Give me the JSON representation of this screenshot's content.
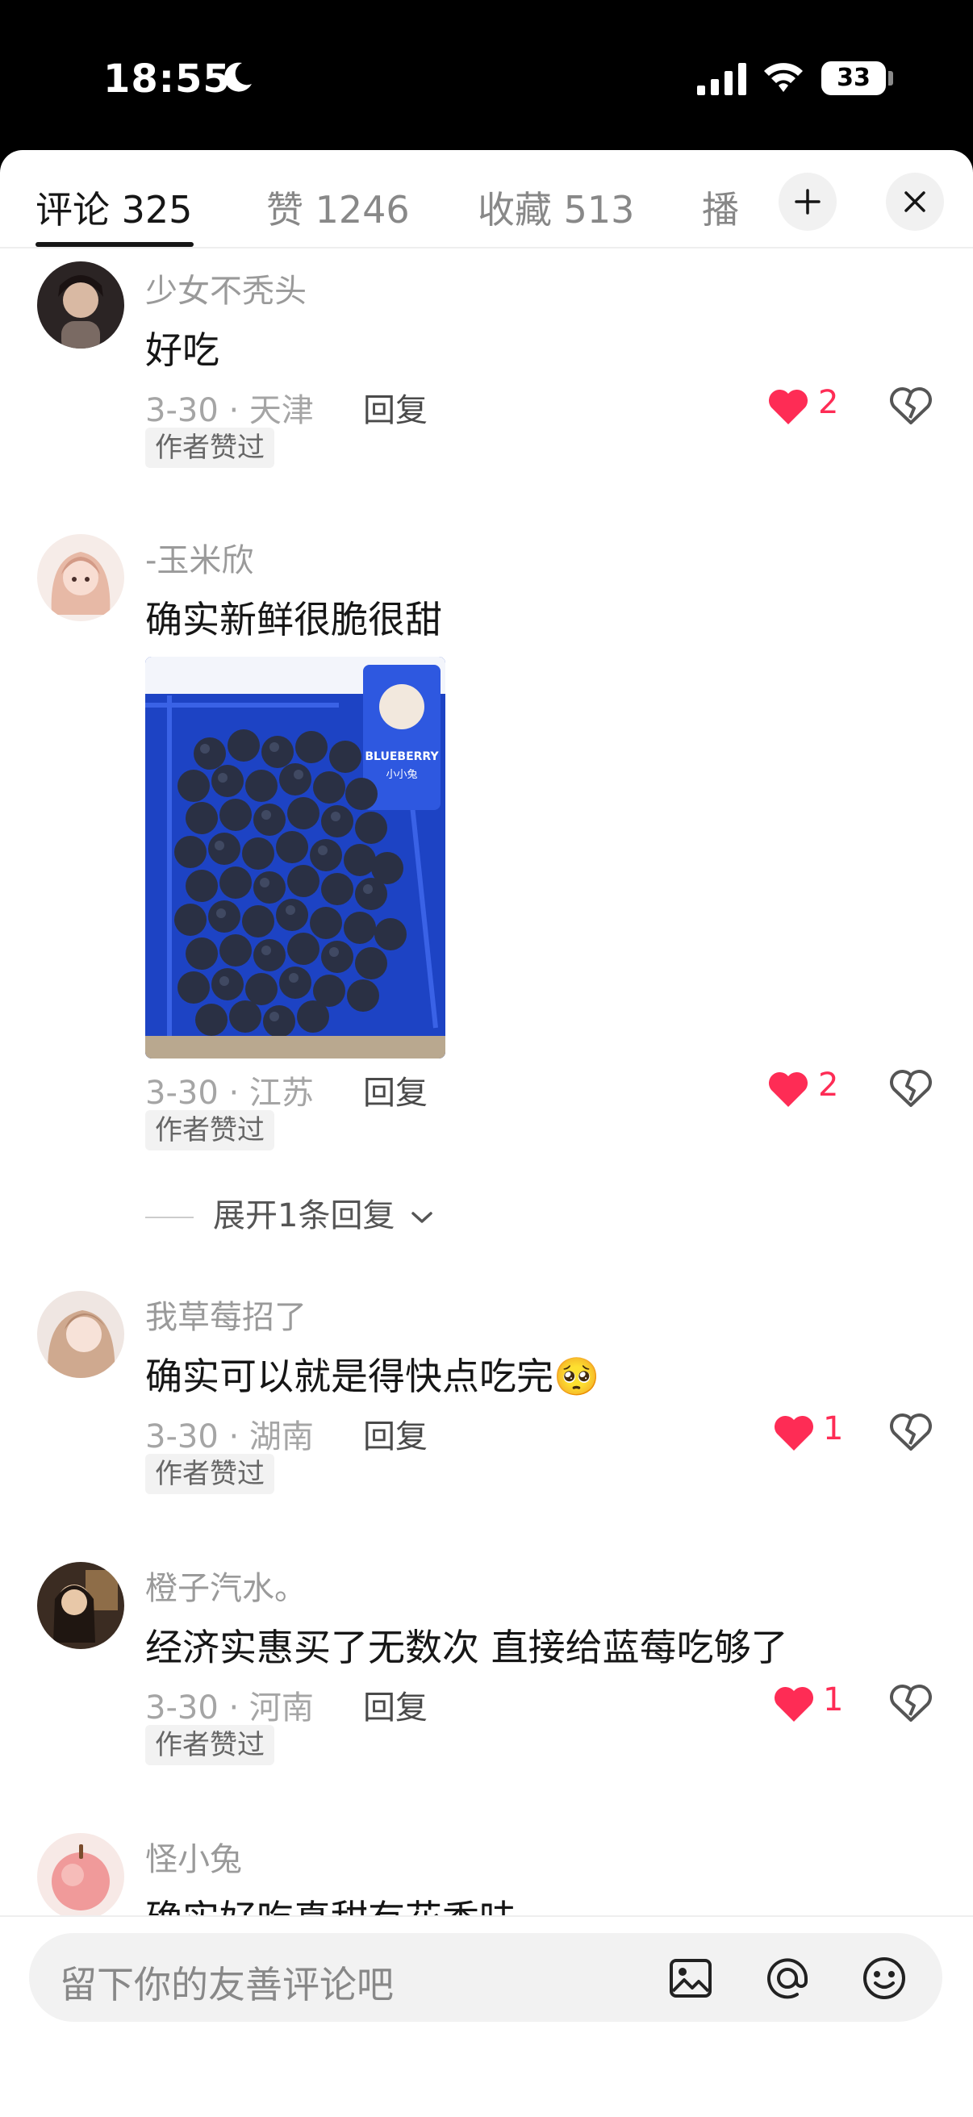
{
  "status": {
    "time": "18:55",
    "battery": "33"
  },
  "tabs": [
    {
      "label": "评论 325"
    },
    {
      "label": "赞 1246"
    },
    {
      "label": "收藏 513"
    },
    {
      "label": "播"
    }
  ],
  "comments": [
    {
      "name": "少女不秃头",
      "text": "好吃",
      "meta": "3-30 · 天津",
      "reply": "回复",
      "likes": "2",
      "badge": "作者赞过"
    },
    {
      "name": "-玉米欣",
      "text": "确实新鲜很脆很甜",
      "meta": "3-30 · 江苏",
      "reply": "回复",
      "likes": "2",
      "badge": "作者赞过",
      "expand": "展开1条回复"
    },
    {
      "name": "我草莓招了",
      "text": "确实可以就是得快点吃完🥺",
      "meta": "3-30 · 湖南",
      "reply": "回复",
      "likes": "1",
      "badge": "作者赞过"
    },
    {
      "name": "橙子汽水。",
      "text": "经济实惠买了无数次 直接给蓝莓吃够了",
      "meta": "3-30 · 河南",
      "reply": "回复",
      "likes": "1",
      "badge": "作者赞过"
    },
    {
      "name": "怪小兔",
      "text": "确实好吃真甜有花香味"
    }
  ],
  "photo_label": "BLUEBERRY",
  "photo_sub": "小小兔",
  "input": {
    "placeholder": "留下你的友善评论吧"
  },
  "colors": {
    "like": "#fe2c55",
    "accent_text": "#161616"
  }
}
